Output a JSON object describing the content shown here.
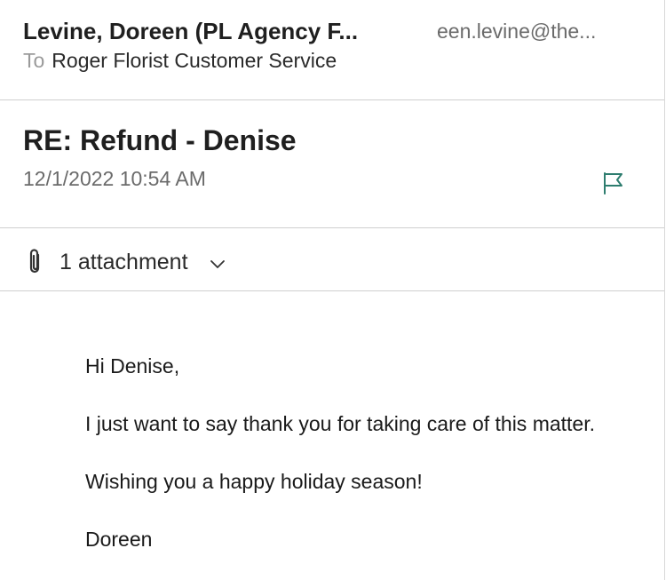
{
  "header": {
    "sender_name": "Levine, Doreen (PL Agency F...",
    "sender_email": "een.levine@the...",
    "to_label": "To",
    "to_value": "Roger Florist Customer Service"
  },
  "message": {
    "subject": "RE: Refund - Denise",
    "date": "12/1/2022 10:54 AM",
    "flag_icon": "flag-icon"
  },
  "attachments": {
    "label": "1 attachment",
    "icon": "paperclip-icon"
  },
  "body": {
    "greeting": "Hi Denise,",
    "paragraph1": "I just want to say thank you for taking care of this matter.",
    "paragraph2": "Wishing you a happy holiday season!",
    "signature": "Doreen"
  },
  "colors": {
    "accent": "#2e7d6f",
    "divider": "#cfcfcf",
    "muted_text": "#6b6b6b"
  }
}
